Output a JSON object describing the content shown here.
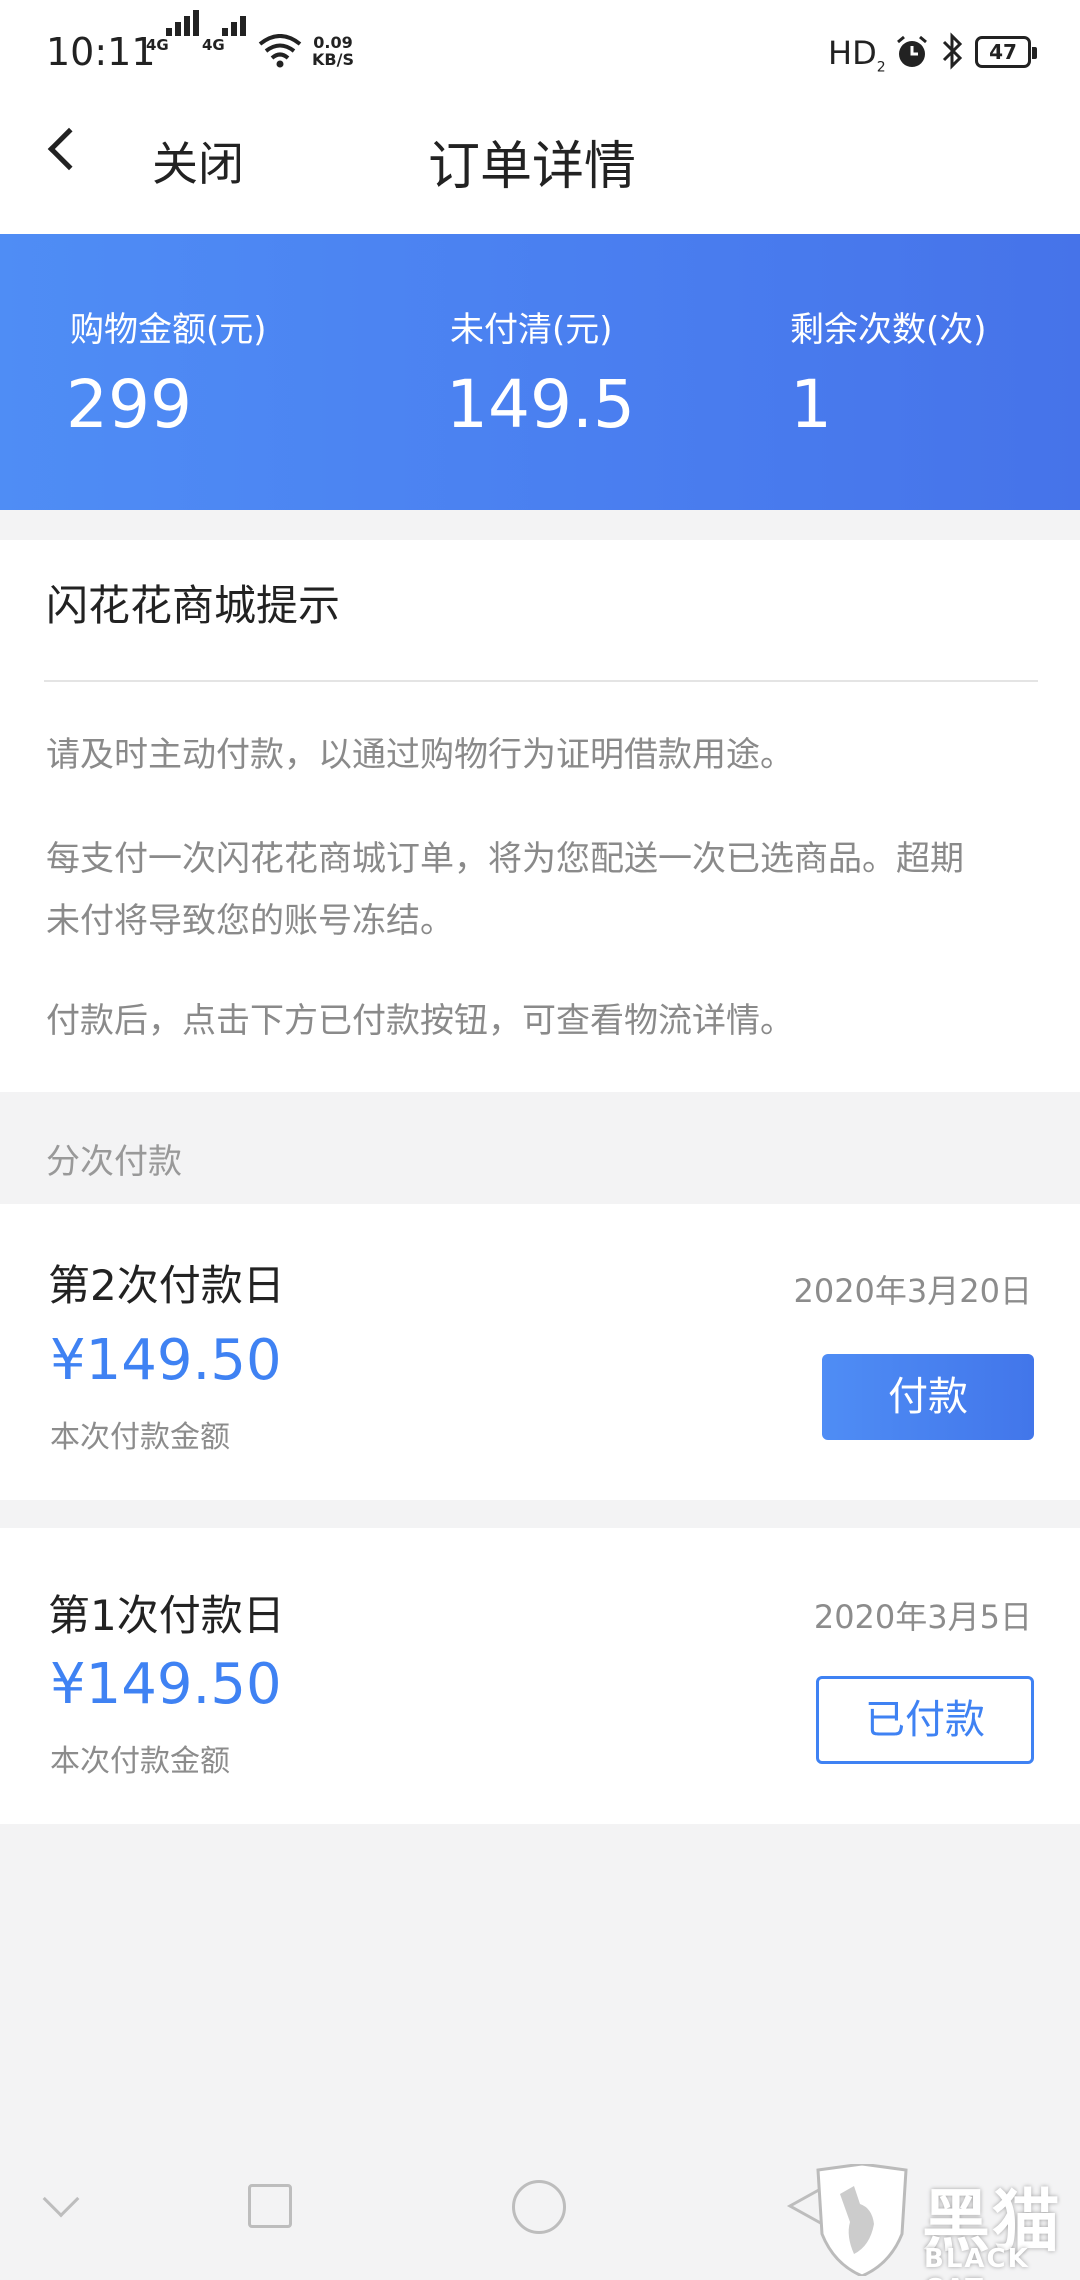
{
  "status_bar": {
    "time": "10:11",
    "net1": "4G",
    "net2": "4G",
    "speed_value": "0.09",
    "speed_unit": "KB/S",
    "hd": "HD",
    "hd_sub": "2",
    "battery": "47"
  },
  "header": {
    "close_label": "关闭",
    "title": "订单详情"
  },
  "summary": {
    "items": [
      {
        "label": "购物金额(元)",
        "value": "299"
      },
      {
        "label": "未付清(元)",
        "value": "149.5"
      },
      {
        "label": "剩余次数(次)",
        "value": "1"
      }
    ]
  },
  "tip": {
    "title": "闪花花商城提示",
    "lines": [
      "请及时主动付款，以通过购物行为证明借款用途。",
      "每支付一次闪花花商城订单，将为您配送一次已选商品。超期未付将导致您的账号冻结。",
      "付款后，点击下方已付款按钮，可查看物流详情。"
    ]
  },
  "installments": {
    "section_label": "分次付款",
    "items": [
      {
        "title": "第2次付款日",
        "date": "2020年3月20日",
        "amount": "¥149.50",
        "sub": "本次付款金额",
        "button": "付款"
      },
      {
        "title": "第1次付款日",
        "date": "2020年3月5日",
        "amount": "¥149.50",
        "sub": "本次付款金额",
        "button": "已付款"
      }
    ]
  },
  "watermark": {
    "text": "黑猫",
    "sub": "BLACK CAT"
  },
  "colors": {
    "accent": "#3f82f3",
    "banner_start": "#4f8df5",
    "banner_end": "#4673e9"
  }
}
